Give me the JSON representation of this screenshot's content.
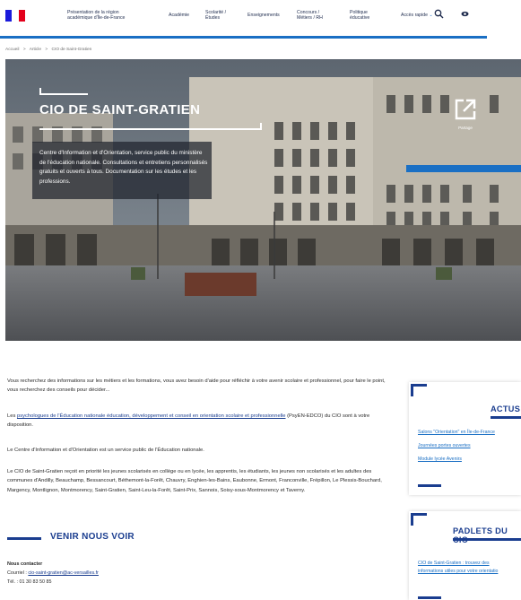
{
  "nav": {
    "flag_colors": [
      "#1a1adb",
      "#ffffff",
      "#e3001b"
    ],
    "items": [
      "Présentation de la région\nacadémique d'Île-de-France",
      "Académie",
      "Scolarité /\nÉtudes",
      "Enseignements",
      "Concours /\nMétiers / RH",
      "Politique\néducative",
      "Accès rapide"
    ],
    "quick_access_chevron": "⌄",
    "search_icon": "search-icon",
    "accessibility_icon": "eye-icon",
    "accent_color": "#1a6fc4"
  },
  "breadcrumb": [
    "Accueil",
    ">",
    "Article",
    ">",
    "CIO de Saint-Gratien"
  ],
  "hero": {
    "title": "CIO DE SAINT-GRATIEN",
    "description": "Centre d'Information et d'Orientation, service public du ministère de l'éducation nationale. Consultations et entretiens personnalisés gratuits et ouverts à tous. Documentation sur les études et les professions.",
    "share_label": "Partage"
  },
  "content": {
    "p1": "Vous recherchez des informations sur les métiers et les formations, vous avez besoin d'aide pour réfléchir à votre avenir scolaire et professionnel, pour faire le point, vous recherchez des conseils pour décider...",
    "p2_prefix": "Les ",
    "p2_link": "psychologues de l'Éducation nationale éducation, développement et conseil en orientation scolaire et professionnelle",
    "p2_suffix": " (PsyEN-EDCO) du CIO sont à votre disposition.",
    "p3": "Le Centre d'Information et d'Orientation est un service public de l'Éducation nationale.",
    "p4": "Le CIO de Saint-Gratien reçoit en priorité les jeunes scolarisés en collège ou en lycée, les apprentis, les étudiants, les jeunes non scolarisés et les adultes des communes d'Andilly, Beauchamp, Bessancourt, Béthemont-la-Forêt, Chauvry, Enghien-les-Bains, Eaubonne, Ermont, Franconville, Frépillon, Le Plessis-Bouchard, Margency, Montlignon, Montmorency, Saint-Gratien, Saint-Leu-la-Forêt, Saint-Prix, Sannois, Soisy-sous-Montmorency et Taverny.",
    "section_title": "VENIR NOUS VOIR",
    "contact_title": "Nous contacter",
    "contact_mail_label": "Courriel : ",
    "contact_mail": "cio-saint-gratien@ac-versailles.fr",
    "contact_tel": "Tél. : 01 30 83 50 85"
  },
  "sidebar": {
    "actus": {
      "title": "ACTUS",
      "links": [
        "Salons \"Orientation\" en Île-de-France",
        "Journées portes ouvertes",
        "Module lycée Avenirs"
      ]
    },
    "padlets": {
      "title": "PADLETS DU CIO",
      "links": [
        "CIO de Saint-Gratien : trouvez des",
        "informations utiles pour votre orientatio"
      ]
    }
  }
}
